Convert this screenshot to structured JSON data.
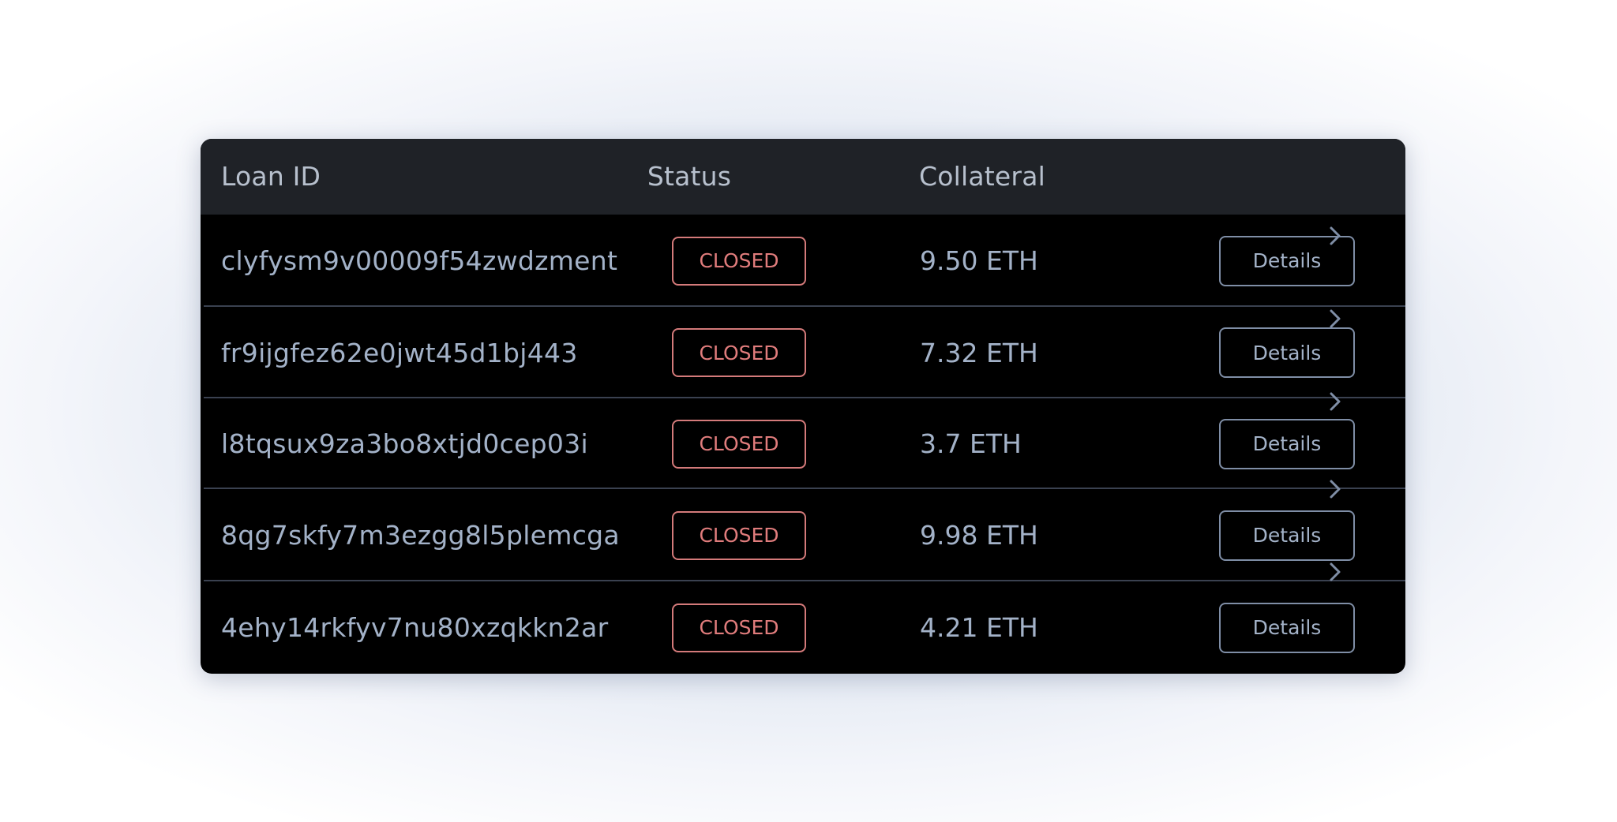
{
  "table": {
    "headers": {
      "loan_id": "Loan ID",
      "status": "Status",
      "collateral": "Collateral"
    },
    "rows": [
      {
        "loan_id": "clyfysm9v00009f54zwdzment",
        "status": "CLOSED",
        "collateral": "9.50 ETH",
        "action": "Details"
      },
      {
        "loan_id": "fr9ijgfez62e0jwt45d1bj443",
        "status": "CLOSED",
        "collateral": "7.32 ETH",
        "action": "Details"
      },
      {
        "loan_id": "l8tqsux9za3bo8xtjd0cep03i",
        "status": "CLOSED",
        "collateral": "3.7 ETH",
        "action": "Details"
      },
      {
        "loan_id": "8qg7skfy7m3ezgg8l5plemcga",
        "status": "CLOSED",
        "collateral": "9.98 ETH",
        "action": "Details"
      },
      {
        "loan_id": "4ehy14rkfyv7nu80xzqkkn2ar",
        "status": "CLOSED",
        "collateral": "4.21 ETH",
        "action": "Details"
      }
    ]
  },
  "icons": {
    "row_arrow": "chevron-right-icon"
  },
  "colors": {
    "card_background": "#000000",
    "header_background": "#1f2227",
    "header_text": "#b7c0cd",
    "cell_text": "#a3b2c8",
    "status_closed": "#e07c7c",
    "button_border": "#7f8ea6",
    "divider": "#3a4150"
  }
}
